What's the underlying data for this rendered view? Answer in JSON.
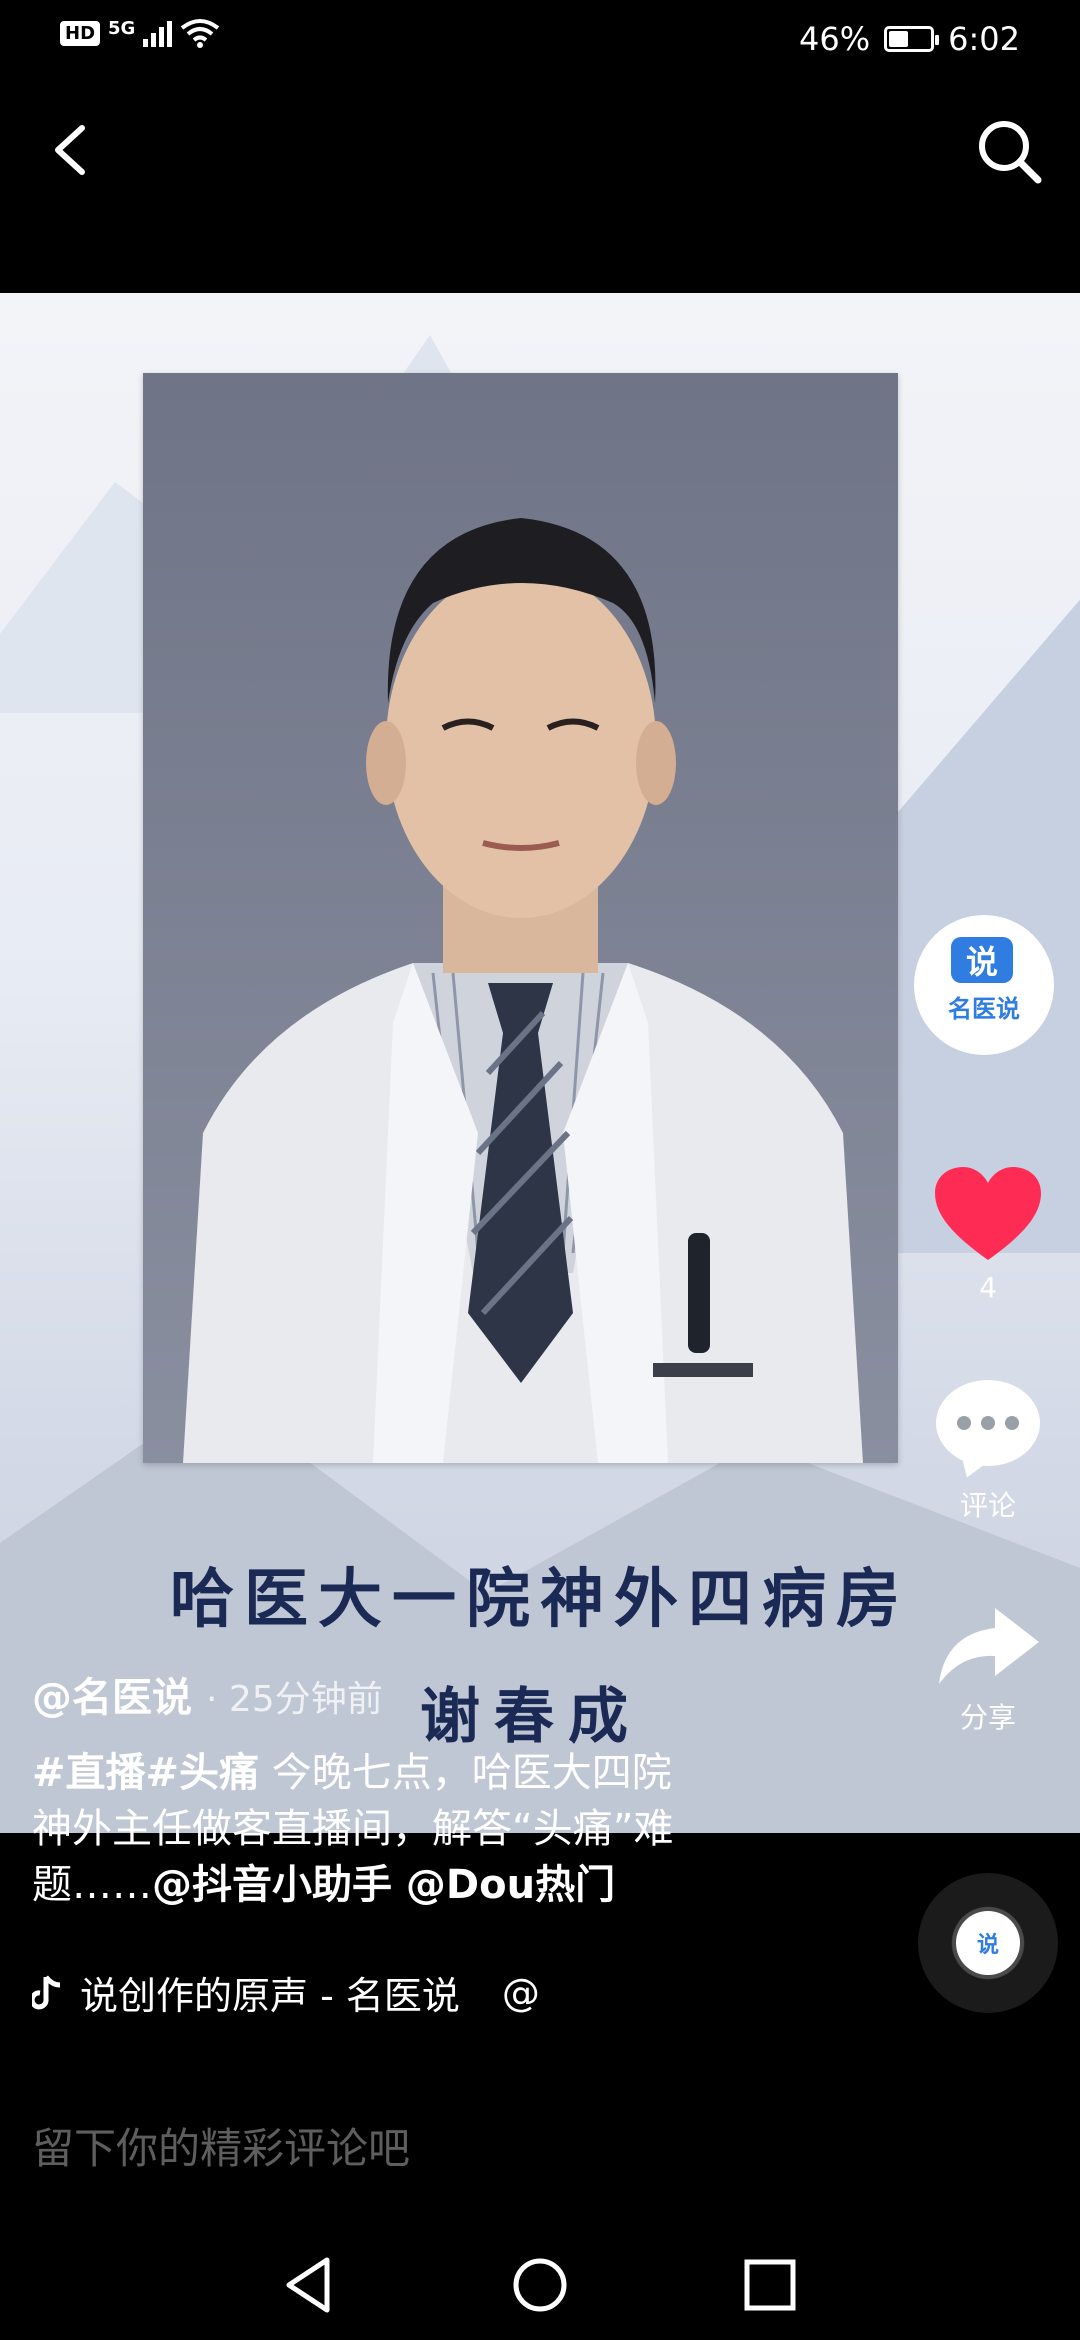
{
  "status_bar": {
    "hd": "HD",
    "network": "5G",
    "battery": "46%",
    "battery_level": 0.46,
    "time": "6:02"
  },
  "nav": {
    "back_icon": "chevron-left-icon",
    "search_icon": "search-icon"
  },
  "video": {
    "caption_line1": "哈医大一院神外四病房",
    "caption_line2": "谢春成"
  },
  "sidebar": {
    "avatar_badge": "说",
    "avatar_text": "名医说",
    "like_count": "4",
    "comment_label": "评论",
    "share_label": "分享"
  },
  "post": {
    "author": "@名医说",
    "time": "· 25分钟前",
    "hashtags": "#直播#头痛",
    "text_line1": " 今晚七点，哈医大四院",
    "text_line2": "神外主任做客直播间，解答“头痛”难",
    "text_line3_prefix": "题……",
    "mentions": "@抖音小助手 @Dou热门"
  },
  "music": {
    "icon": "music-note-icon",
    "title": "说创作的原声 - 名医说",
    "tail": "@"
  },
  "comment_input": {
    "placeholder": "留下你的精彩评论吧"
  },
  "colors": {
    "like": "#fe2c55",
    "brand": "#2f7de1",
    "caption": "#1b2a55"
  }
}
